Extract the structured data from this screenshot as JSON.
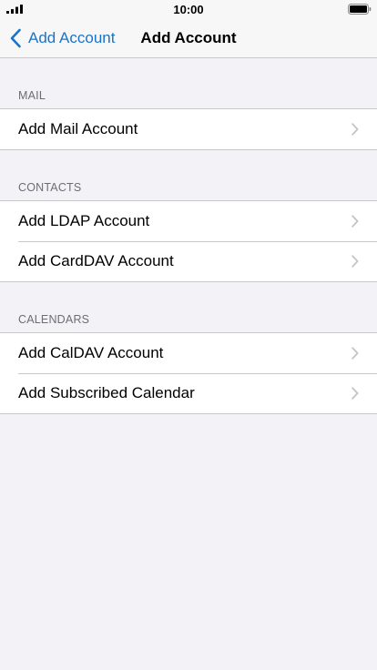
{
  "status_bar": {
    "time": "10:00"
  },
  "nav": {
    "back_label": "Add Account",
    "title": "Add Account"
  },
  "sections": [
    {
      "header": "MAIL",
      "items": [
        {
          "label": "Add Mail Account"
        }
      ]
    },
    {
      "header": "CONTACTS",
      "items": [
        {
          "label": "Add LDAP Account"
        },
        {
          "label": "Add CardDAV Account"
        }
      ]
    },
    {
      "header": "CALENDARS",
      "items": [
        {
          "label": "Add CalDAV Account"
        },
        {
          "label": "Add Subscribed Calendar"
        }
      ]
    }
  ],
  "colors": {
    "accent": "#1a73c9",
    "background": "#f2f2f7",
    "separator": "#c8c7cc",
    "section_header_text": "#6d6d72",
    "chevron": "#c4c4c7"
  },
  "icons": {
    "signal": "cellular-signal-icon",
    "battery": "battery-icon",
    "back": "chevron-left-icon",
    "disclosure": "chevron-right-icon"
  }
}
